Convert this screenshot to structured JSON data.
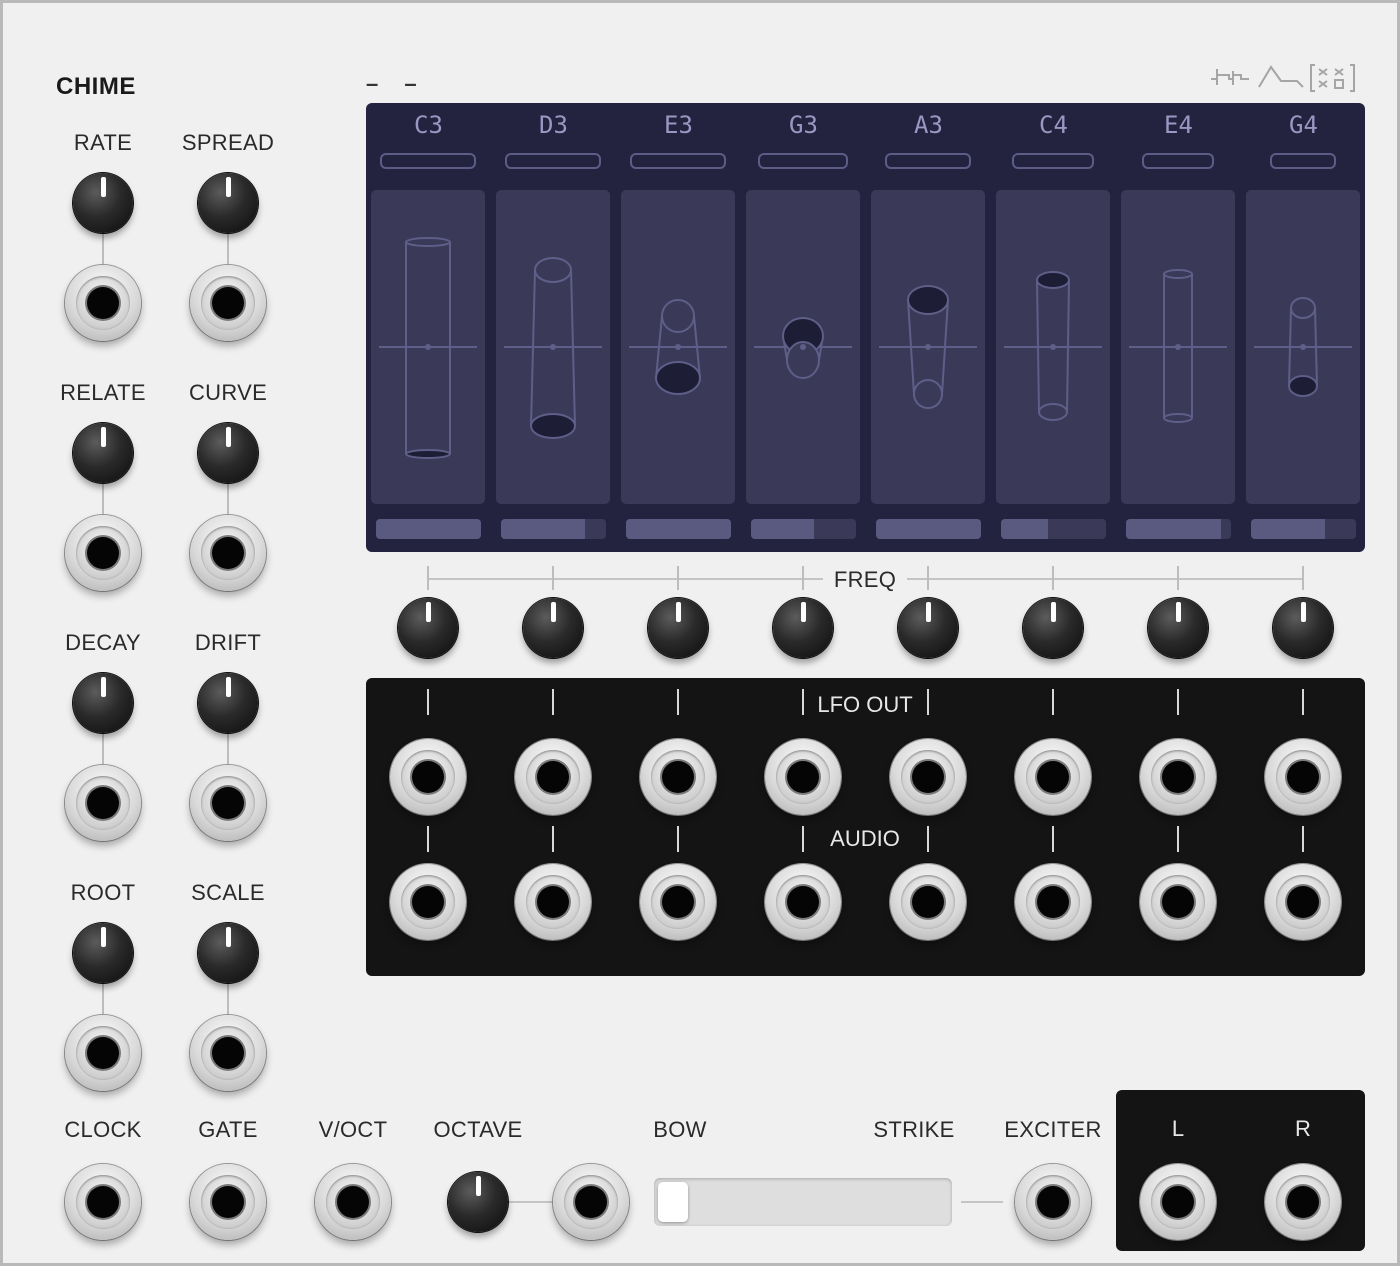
{
  "module": {
    "title": "CHIME",
    "header_dashes": "– –"
  },
  "left_controls": [
    {
      "label": "RATE"
    },
    {
      "label": "SPREAD"
    },
    {
      "label": "RELATE"
    },
    {
      "label": "CURVE"
    },
    {
      "label": "DECAY"
    },
    {
      "label": "DRIFT"
    },
    {
      "label": "ROOT"
    },
    {
      "label": "SCALE"
    }
  ],
  "notes": [
    {
      "name": "C3",
      "level": 1.0,
      "cylinder": "tall-bottom"
    },
    {
      "name": "D3",
      "level": 0.8,
      "cylinder": "tall-bottom-filled"
    },
    {
      "name": "E3",
      "level": 1.0,
      "cylinder": "short-mid-filled"
    },
    {
      "name": "G3",
      "level": 0.6,
      "cylinder": "ring-mid"
    },
    {
      "name": "A3",
      "level": 1.0,
      "cylinder": "tall-top-filled"
    },
    {
      "name": "C4",
      "level": 0.45,
      "cylinder": "tall-top"
    },
    {
      "name": "E4",
      "level": 0.9,
      "cylinder": "tall-center"
    },
    {
      "name": "G4",
      "level": 0.7,
      "cylinder": "short-low-filled"
    }
  ],
  "sections": {
    "freq": "FREQ",
    "lfo_out": "LFO OUT",
    "audio": "AUDIO"
  },
  "bottom_labels": {
    "clock": "CLOCK",
    "gate": "GATE",
    "voct": "V/OCT",
    "octave": "OCTAVE",
    "bow": "BOW",
    "strike": "STRIKE",
    "exciter": "EXCITER",
    "out_l": "L",
    "out_r": "R"
  },
  "bow_strike_slider": {
    "value": 0.0
  },
  "colors": {
    "panel": "#f0f0f0",
    "screen": "#24233f",
    "screen_column": "#3a3958",
    "note_text": "#9a98c2",
    "dark_section": "#141414"
  },
  "icons": [
    "waveform-icon",
    "envelope-icon",
    "random-icon"
  ]
}
